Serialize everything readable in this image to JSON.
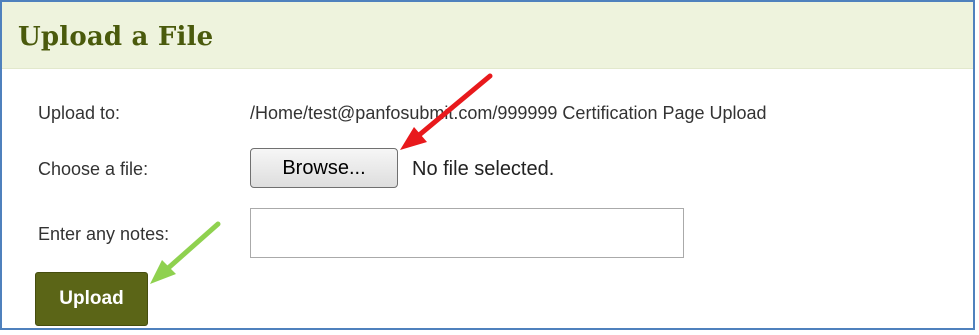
{
  "header": {
    "title": "Upload a File"
  },
  "form": {
    "upload_to_label": "Upload to:",
    "upload_to_value": "/Home/test@panfosubmit.com/999999 Certification Page Upload",
    "choose_file_label": "Choose a file:",
    "browse_label": "Browse...",
    "file_status": "No file selected.",
    "notes_label": "Enter any notes:",
    "notes_value": "",
    "notes_placeholder": "",
    "upload_label": "Upload"
  },
  "annotations": {
    "arrow_to_browse": {
      "color": "#e8191c",
      "icon": "red-arrow-icon"
    },
    "arrow_to_upload": {
      "color": "#8fd14f",
      "icon": "green-arrow-icon"
    }
  },
  "colors": {
    "title_text": "#4a5a0c",
    "title_bg": "#eef3dd",
    "border": "#4f81bd",
    "upload_button": "#5b6517"
  }
}
